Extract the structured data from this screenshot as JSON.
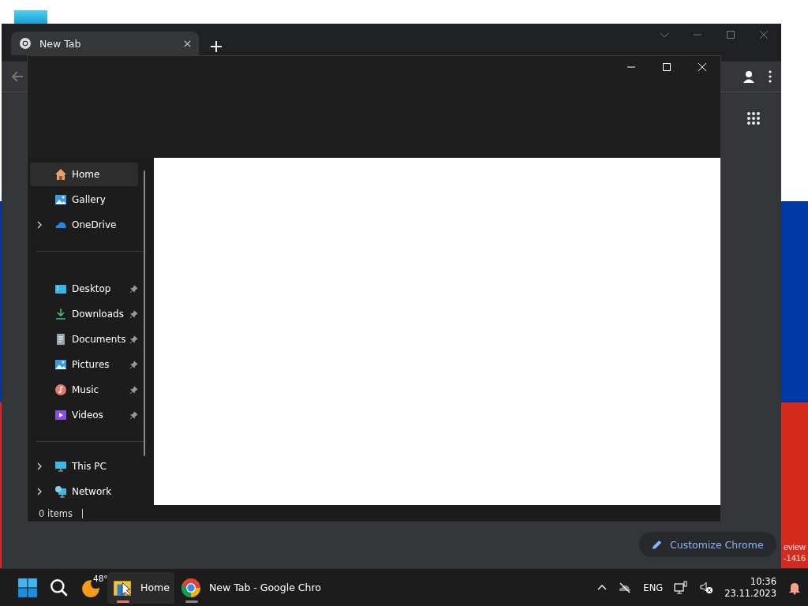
{
  "desktop": {
    "watermark_lines": [
      "eview",
      "-1416"
    ]
  },
  "chrome": {
    "tabs": [
      {
        "title": "New Tab",
        "selected": true
      }
    ],
    "customize_button": "Customize Chrome"
  },
  "explorer": {
    "sidebar": [
      [
        {
          "label": "Home",
          "kind": "home",
          "selected": true,
          "expandable": false,
          "pinned": false
        },
        {
          "label": "Gallery",
          "kind": "gallery",
          "selected": false,
          "expandable": false,
          "pinned": false
        },
        {
          "label": "OneDrive",
          "kind": "cloud",
          "selected": false,
          "expandable": true,
          "pinned": false
        }
      ],
      [
        {
          "label": "Desktop",
          "kind": "desktop",
          "selected": false,
          "expandable": false,
          "pinned": true
        },
        {
          "label": "Downloads",
          "kind": "download",
          "selected": false,
          "expandable": false,
          "pinned": true
        },
        {
          "label": "Documents",
          "kind": "document",
          "selected": false,
          "expandable": false,
          "pinned": true
        },
        {
          "label": "Pictures",
          "kind": "gallery",
          "selected": false,
          "expandable": false,
          "pinned": true
        },
        {
          "label": "Music",
          "kind": "music",
          "selected": false,
          "expandable": false,
          "pinned": true
        },
        {
          "label": "Videos",
          "kind": "video",
          "selected": false,
          "expandable": false,
          "pinned": true
        }
      ],
      [
        {
          "label": "This PC",
          "kind": "monitor",
          "selected": false,
          "expandable": true,
          "pinned": false
        },
        {
          "label": "Network",
          "kind": "network",
          "selected": false,
          "expandable": true,
          "pinned": false
        }
      ]
    ],
    "status": "0 items"
  },
  "taskbar": {
    "apps": [
      {
        "kind": "start",
        "selected": false
      },
      {
        "kind": "search",
        "selected": false
      },
      {
        "kind": "weather",
        "badge": "48°",
        "selected": false
      },
      {
        "kind": "explorer",
        "label": "Home",
        "selected": true
      },
      {
        "kind": "chrome",
        "label": "New Tab - Google Chro",
        "selected": false
      }
    ],
    "tray": {
      "language": "ENG",
      "time": "10:36",
      "date": "23.11.2023"
    }
  }
}
